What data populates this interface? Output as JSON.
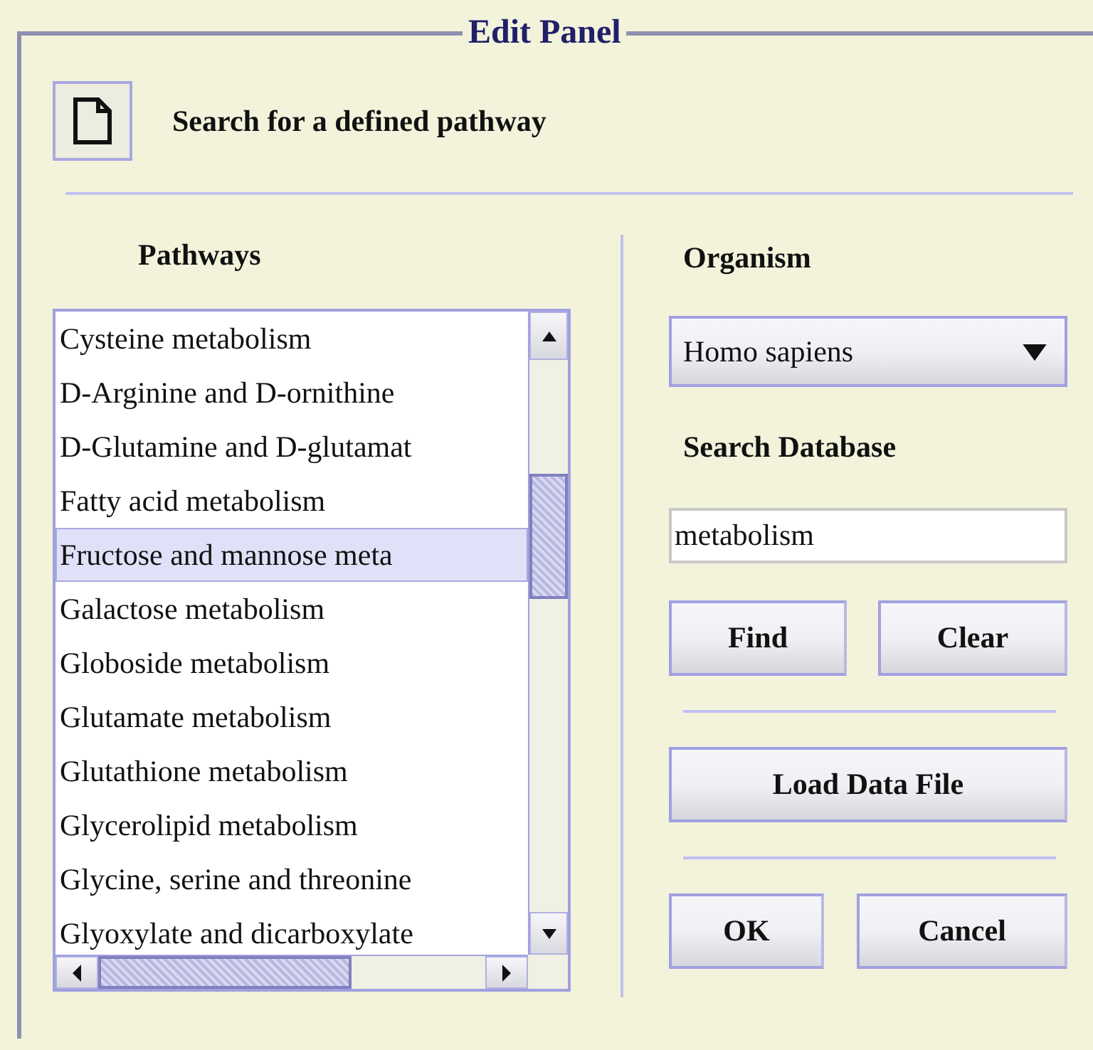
{
  "panel": {
    "title": "Edit Panel"
  },
  "header": {
    "title": "Search for a defined pathway"
  },
  "pathways": {
    "heading": "Pathways",
    "items": [
      {
        "label": "Cysteine metabolism",
        "selected": false
      },
      {
        "label": "D-Arginine and D-ornithine",
        "selected": false
      },
      {
        "label": "D-Glutamine and D-glutamat",
        "selected": false
      },
      {
        "label": "Fatty acid metabolism",
        "selected": false
      },
      {
        "label": "Fructose and mannose meta",
        "selected": true
      },
      {
        "label": "Galactose metabolism",
        "selected": false
      },
      {
        "label": "Globoside metabolism",
        "selected": false
      },
      {
        "label": "Glutamate metabolism",
        "selected": false
      },
      {
        "label": "Glutathione metabolism",
        "selected": false
      },
      {
        "label": "Glycerolipid metabolism",
        "selected": false
      },
      {
        "label": "Glycine, serine and threonine",
        "selected": false
      },
      {
        "label": "Glyoxylate and dicarboxylate",
        "selected": false
      }
    ]
  },
  "organism": {
    "heading": "Organism",
    "value": "Homo sapiens"
  },
  "search": {
    "heading": "Search Database",
    "value": "metabolism"
  },
  "search_buttons": [
    "Find",
    "Clear"
  ],
  "load_button": "Load Data File",
  "dialog_buttons": [
    "OK",
    "Cancel"
  ]
}
